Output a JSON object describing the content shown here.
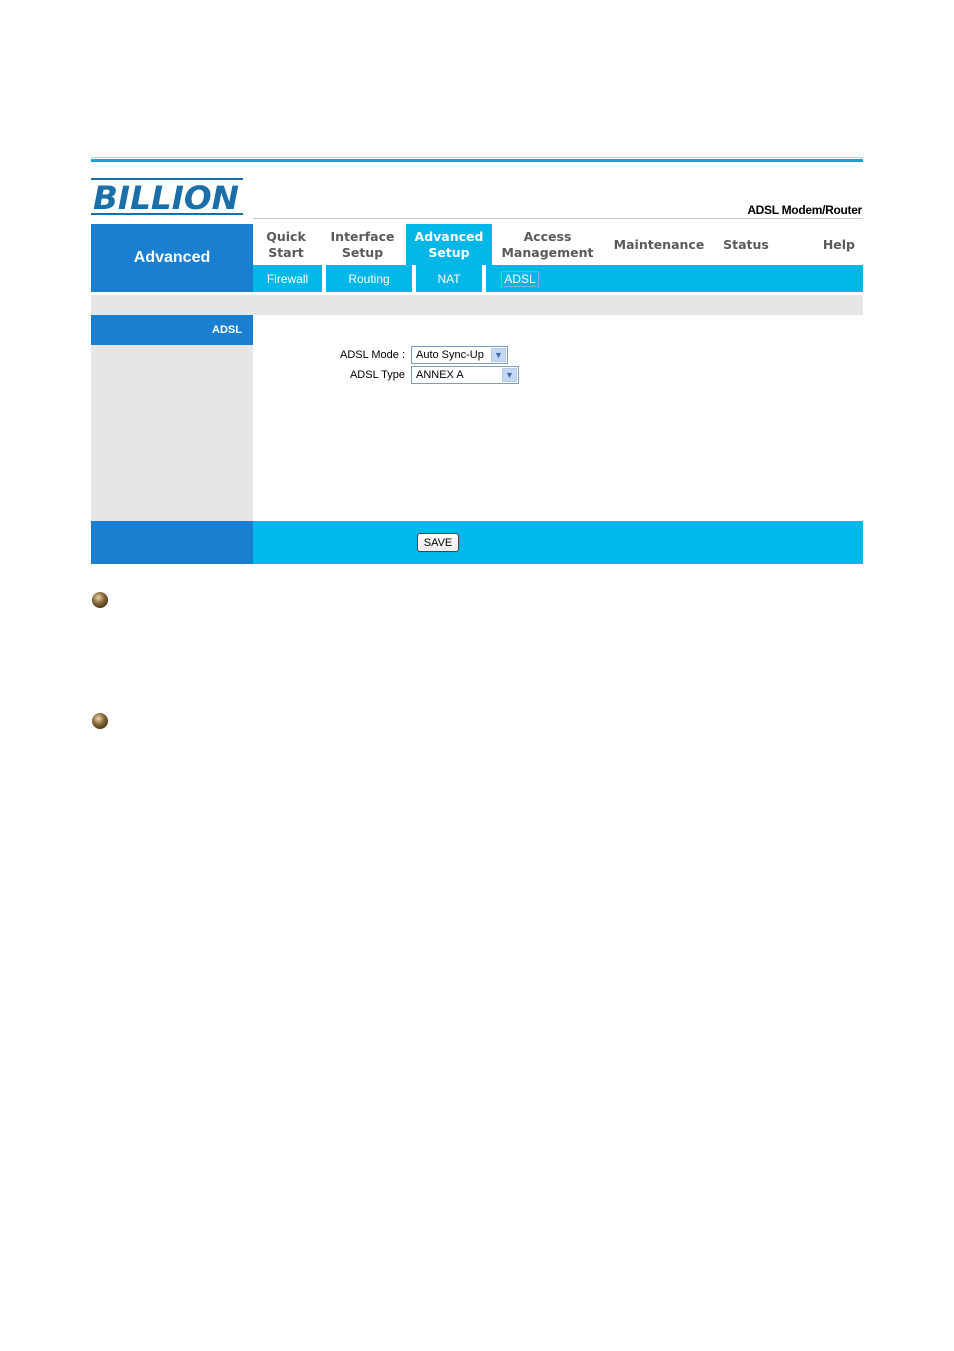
{
  "brand": {
    "logo_text": "BILLION",
    "product_name": "ADSL Modem/Router",
    "colors": {
      "primary_blue": "#1a7fd0",
      "accent_cyan": "#00b7e8",
      "logo_blue": "#1a6fa8"
    }
  },
  "section_title": "Advanced",
  "nav": {
    "items": [
      {
        "label": "Quick\nStart",
        "active": false
      },
      {
        "label": "Interface\nSetup",
        "active": false
      },
      {
        "label": "Advanced\nSetup",
        "active": true
      },
      {
        "label": "Access\nManagement",
        "active": false
      },
      {
        "label": "Maintenance",
        "active": false
      },
      {
        "label": "Status",
        "active": false
      },
      {
        "label": "Help",
        "active": false
      }
    ]
  },
  "subnav": {
    "items": [
      {
        "label": "Firewall",
        "active": false
      },
      {
        "label": "Routing",
        "active": false
      },
      {
        "label": "NAT",
        "active": false
      },
      {
        "label": "ADSL",
        "active": true
      }
    ]
  },
  "sidebar": {
    "title": "ADSL"
  },
  "form": {
    "adsl_mode": {
      "label": "ADSL Mode :",
      "value": "Auto Sync-Up"
    },
    "adsl_type": {
      "label": "ADSL Type",
      "value": "ANNEX A"
    }
  },
  "footer": {
    "save_label": "SAVE"
  }
}
